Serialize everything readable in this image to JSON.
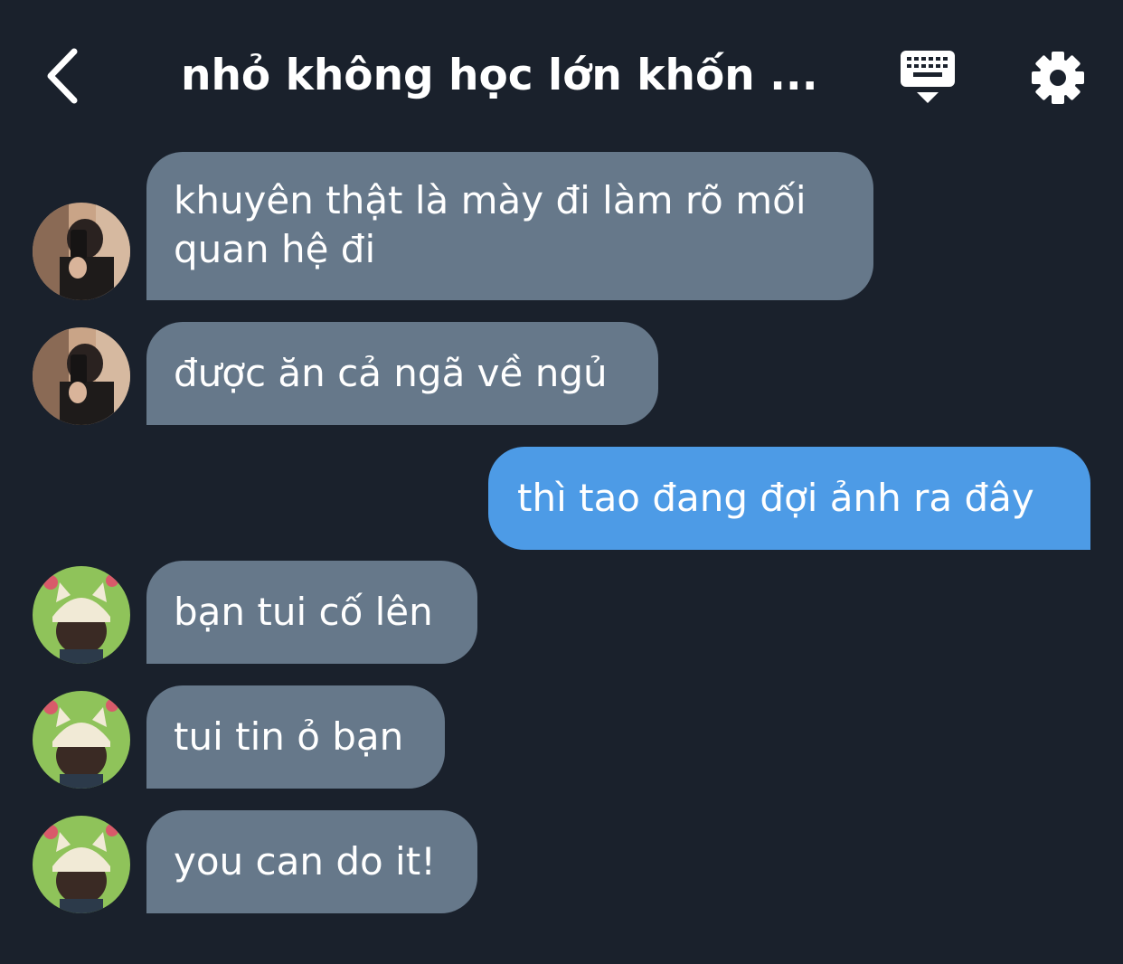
{
  "header": {
    "title": "nhỏ không học lớn khốn ...",
    "back_icon": "chevron-left-icon",
    "keyboard_icon": "keyboard-icon",
    "settings_icon": "gear-icon"
  },
  "colors": {
    "background": "#1a212c",
    "incoming_bubble": "#66788a",
    "outgoing_bubble": "#4d9be6",
    "text": "#ffffff"
  },
  "messages": [
    {
      "direction": "incoming",
      "sender": "user-a",
      "lines": [
        "khuyên thật là mày đi làm rõ mối",
        "quan hệ đi"
      ]
    },
    {
      "direction": "incoming",
      "sender": "user-a",
      "lines": [
        "được ăn cả ngã về ngủ"
      ]
    },
    {
      "direction": "outgoing",
      "sender": "me",
      "lines": [
        "thì tao đang đợi ảnh ra đây"
      ]
    },
    {
      "direction": "incoming",
      "sender": "user-b",
      "lines": [
        "bạn tui cố lên"
      ]
    },
    {
      "direction": "incoming",
      "sender": "user-b",
      "lines": [
        "tui tin ỏ bạn"
      ]
    },
    {
      "direction": "incoming",
      "sender": "user-b",
      "lines": [
        "you can do it!"
      ]
    }
  ]
}
